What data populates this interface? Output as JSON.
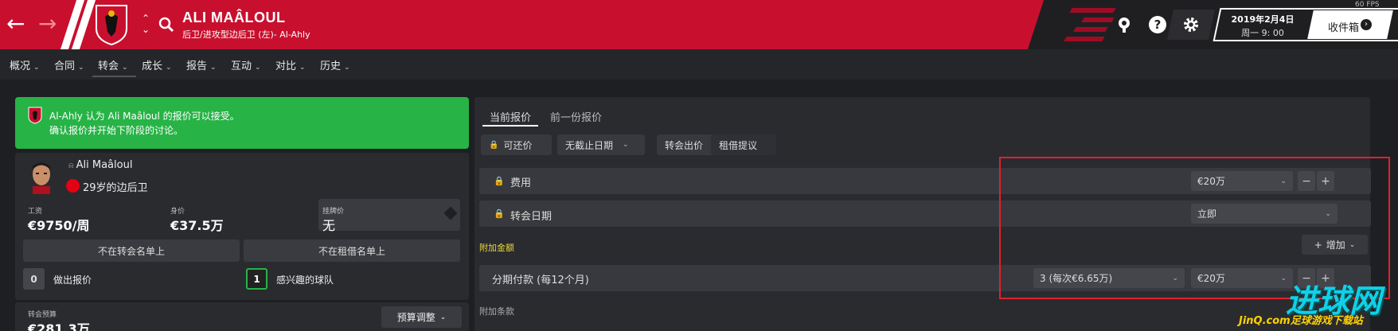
{
  "header": {
    "back_icon": "arrow-left-icon",
    "forward_icon": "arrow-right-icon",
    "player_name": "ALI MAÂLOUL",
    "player_position": "后卫/进攻型边后卫 (左)- Al-Ahly",
    "date": "2019年2月4日",
    "time": "周一 9: 00",
    "inbox_label": "收件箱",
    "fps": "60 FPS",
    "colors": {
      "brand": "#c8102e",
      "dark": "#1f1f22"
    }
  },
  "tabs": [
    {
      "label": "概况"
    },
    {
      "label": "合同"
    },
    {
      "label": "转会"
    },
    {
      "label": "成长"
    },
    {
      "label": "报告"
    },
    {
      "label": "互动"
    },
    {
      "label": "对比"
    },
    {
      "label": "历史"
    }
  ],
  "banner": {
    "line1": "Al-Ahly 认为 Ali Maâloul 的报价可以接受。",
    "line2": "确认报价并开始下阶段的讨论。",
    "color": "#27b346"
  },
  "player": {
    "name": "Ali Maâloul",
    "age_position": "29岁的边后卫",
    "wage_label": "工资",
    "wage_value": "€9750/周",
    "value_label": "身价",
    "value_value": "€37.5万",
    "asking_label": "挂牌价",
    "asking_value": "无",
    "transfer_list": "不在转会名单上",
    "loan_list": "不在租借名单上",
    "offers_count": "0",
    "offers_label": "做出报价",
    "interested_count": "1",
    "interested_label": "感兴趣的球队"
  },
  "budget": {
    "label": "转会预算",
    "value": "€281.3万",
    "adjust_label": "预算调整"
  },
  "offer": {
    "tabs": [
      "当前报价",
      "前一份报价"
    ],
    "chips": {
      "negotiable": "可还价",
      "deadline": "无截止日期",
      "transfer_bid": "转会出价",
      "loan_offer": "租借提议"
    },
    "fee_label": "费用",
    "fee_value": "€20万",
    "date_label": "转会日期",
    "date_value": "立即",
    "addons_label": "附加金额",
    "add_label": "增加",
    "installments_label": "分期付款 (每12个月)",
    "installments_value": "3 (每次€6.65万)",
    "installments_amount": "€20万",
    "clauses_label": "附加条款"
  },
  "watermark": {
    "main": "进球网",
    "sub": "JinQ.com足球游戏下载站"
  }
}
